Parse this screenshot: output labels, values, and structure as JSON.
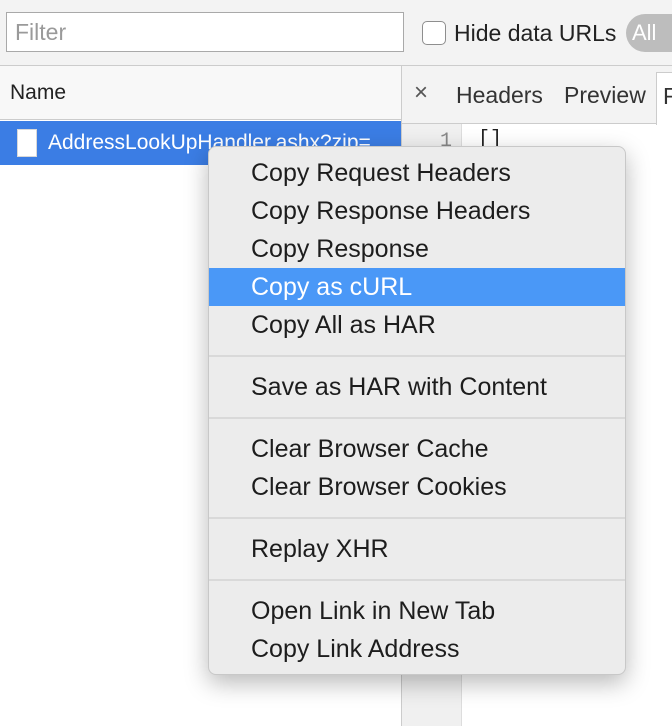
{
  "toolbar": {
    "filter_placeholder": "Filter",
    "hide_data_urls_label": "Hide data URLs",
    "all_label": "All"
  },
  "requests": {
    "column_name": "Name",
    "rows": [
      {
        "name": "AddressLookUpHandler.ashx?zip=",
        "selected": true
      }
    ]
  },
  "detail": {
    "close_symbol": "×",
    "tabs": [
      "Headers",
      "Preview",
      "R"
    ],
    "line_number": "1",
    "code": "[]"
  },
  "context_menu": {
    "groups": [
      [
        "Copy Request Headers",
        "Copy Response Headers",
        "Copy Response",
        "Copy as cURL",
        "Copy All as HAR"
      ],
      [
        "Save as HAR with Content"
      ],
      [
        "Clear Browser Cache",
        "Clear Browser Cookies"
      ],
      [
        "Replay XHR"
      ],
      [
        "Open Link in New Tab",
        "Copy Link Address"
      ]
    ],
    "highlighted": "Copy as cURL"
  },
  "colors": {
    "selection": "#3b7de4",
    "menu_highlight": "#4a98f7"
  }
}
